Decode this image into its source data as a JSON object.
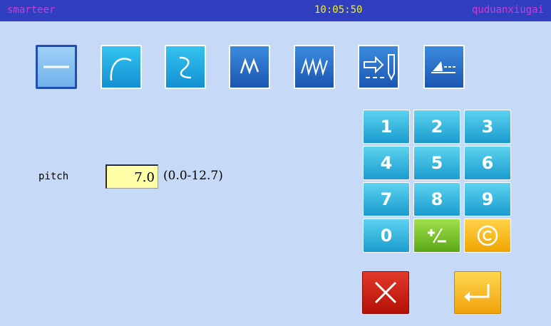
{
  "header": {
    "brand": "smarteer",
    "time": "10:05:50",
    "mode": "quduanxiugai"
  },
  "tools": [
    {
      "icon": "straight-line-icon",
      "selected": true
    },
    {
      "icon": "arc-icon",
      "selected": false
    },
    {
      "icon": "curve-icon",
      "selected": false
    },
    {
      "icon": "zigzag-icon",
      "selected": false
    },
    {
      "icon": "multi-zigzag-icon",
      "selected": false
    },
    {
      "icon": "feed-arrow-needle-icon",
      "selected": false
    },
    {
      "icon": "presser-foot-icon",
      "selected": false
    }
  ],
  "field": {
    "label": "pitch",
    "value": "7.0",
    "range": "(0.0-12.7)"
  },
  "keypad": [
    "1",
    "2",
    "3",
    "4",
    "5",
    "6",
    "7",
    "8",
    "9",
    "0"
  ],
  "keypad_special": {
    "sign_icon": "plus-minus-icon",
    "clear_icon": "copyright-clear-icon"
  },
  "actions": {
    "cancel_icon": "close-icon",
    "enter_icon": "enter-icon"
  },
  "colors": {
    "background": "#c6d9f7",
    "titlebar": "#2f3fbf",
    "brand": "#d23bd6",
    "clock": "#f4f01c",
    "key": "#1a9ccf",
    "cancel": "#c8180c",
    "enter": "#f5b820"
  }
}
